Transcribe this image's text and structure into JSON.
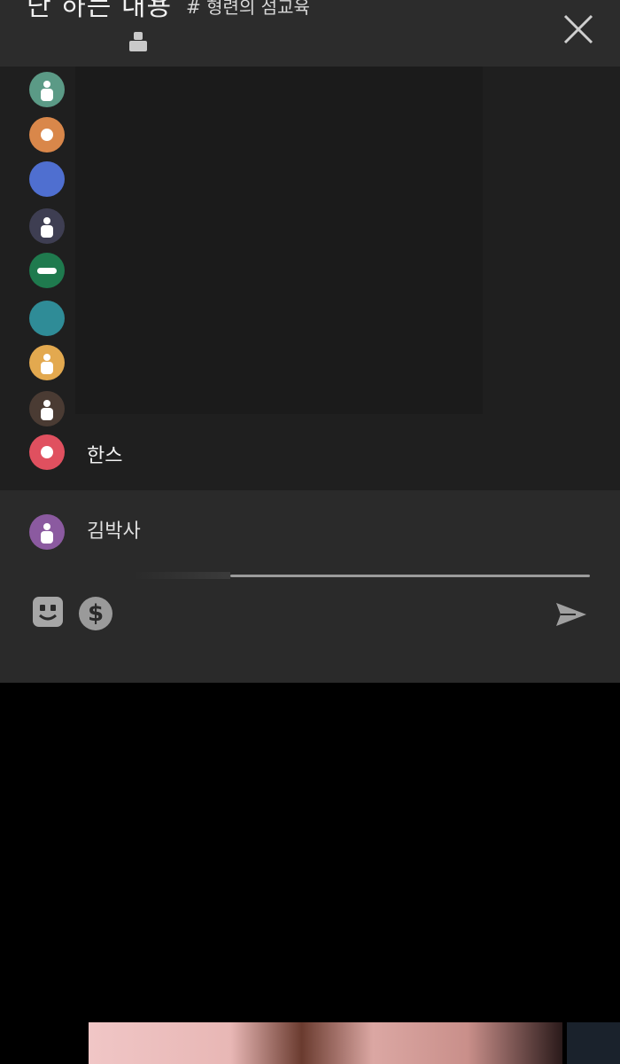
{
  "header": {
    "title": "단 하는 내용",
    "tag": "# 형련의 섬교육",
    "close_icon": "close-icon",
    "user_icon": "user-icon"
  },
  "chat": {
    "avatars": [
      {
        "color": "#5b9a86",
        "icon": "person"
      },
      {
        "color": "#d9874a",
        "icon": "dot"
      },
      {
        "color": "#4f6fd0",
        "icon": "none"
      },
      {
        "color": "#3e3e52",
        "icon": "person"
      },
      {
        "color": "#1f7a4e",
        "icon": "bar"
      },
      {
        "color": "#2f8c97",
        "icon": "none"
      },
      {
        "color": "#e3a94f",
        "icon": "person"
      },
      {
        "color": "#4a3b33",
        "icon": "person"
      },
      {
        "color": "#e0505f",
        "icon": "dot",
        "name": "한스"
      }
    ]
  },
  "compose": {
    "avatar_color": "#8b5aa0",
    "name": "김박사",
    "sticker_icon": "sticker-icon",
    "coin_icon": "dollar-icon",
    "coin_symbol": "$",
    "send_icon": "send-icon"
  }
}
